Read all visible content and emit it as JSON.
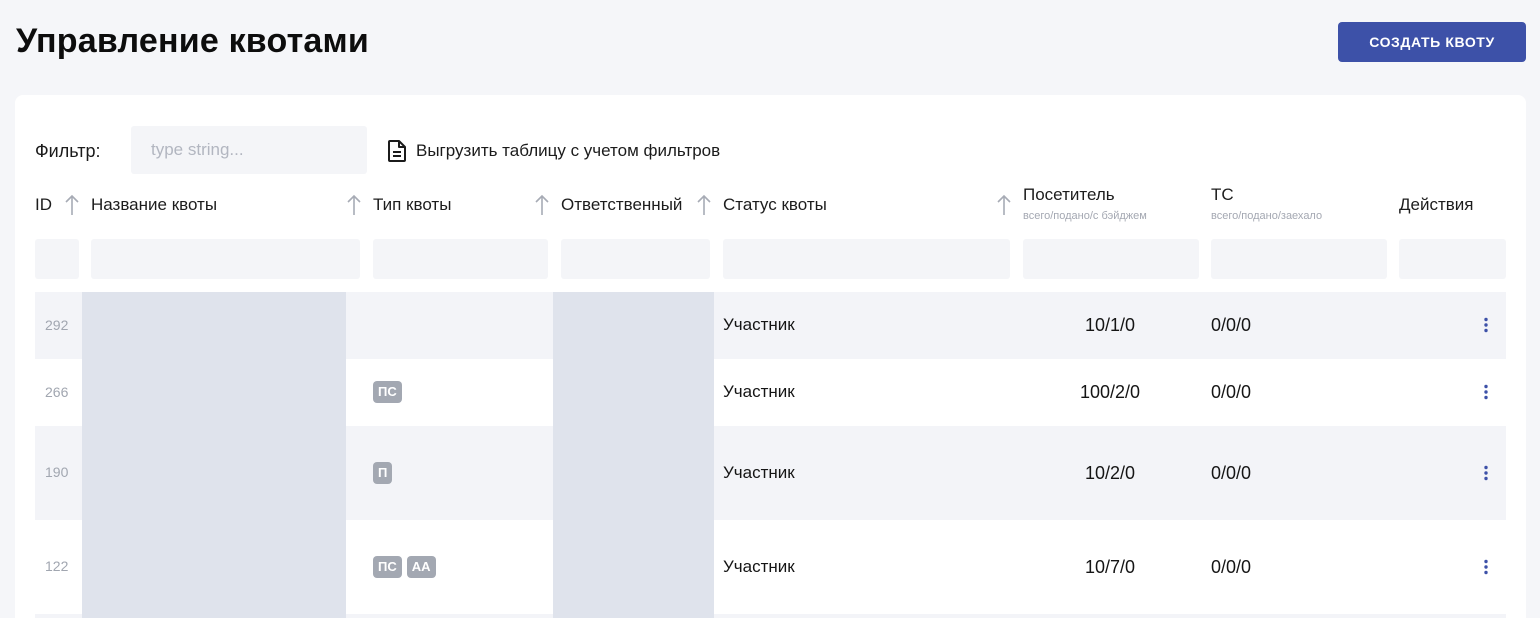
{
  "header": {
    "title": "Управление квотами",
    "create_button": "СОЗДАТЬ КВОТУ"
  },
  "filter": {
    "label": "Фильтр:",
    "placeholder": "type string...",
    "value": "",
    "export_label": "Выгрузить таблицу с учетом фильтров",
    "export_icon": "document-icon"
  },
  "table": {
    "columns": {
      "id": "ID",
      "name": "Название квоты",
      "type": "Тип квоты",
      "responsible": "Ответственный",
      "status": "Статус квоты",
      "visitor": "Посетитель",
      "visitor_sub": "всего/подано/с бэйджем",
      "tc": "ТС",
      "tc_sub": "всего/подано/заехало",
      "actions": "Действия"
    },
    "sort_icon": "arrow-up-icon",
    "rows": [
      {
        "id": "292",
        "tags": [],
        "status": "Участник",
        "visitor": "10/1/0",
        "tc": "0/0/0",
        "shaded": true
      },
      {
        "id": "266",
        "tags": [
          "ПС"
        ],
        "status": "Участник",
        "visitor": "100/2/0",
        "tc": "0/0/0",
        "shaded": false
      },
      {
        "id": "190",
        "tags": [
          "П"
        ],
        "status": "Участник",
        "visitor": "10/2/0",
        "tc": "0/0/0",
        "shaded": true
      },
      {
        "id": "122",
        "tags": [
          "ПС",
          "АА"
        ],
        "status": "Участник",
        "visitor": "10/7/0",
        "tc": "0/0/0",
        "shaded": false
      }
    ],
    "row_actions_icon": "kebab-menu-icon"
  },
  "colors": {
    "accent": "#3d51a8",
    "background": "#f5f6f9",
    "row_shade": "#f3f4f8",
    "mask": "#dfe3ec",
    "tag": "#a3a8b2"
  }
}
